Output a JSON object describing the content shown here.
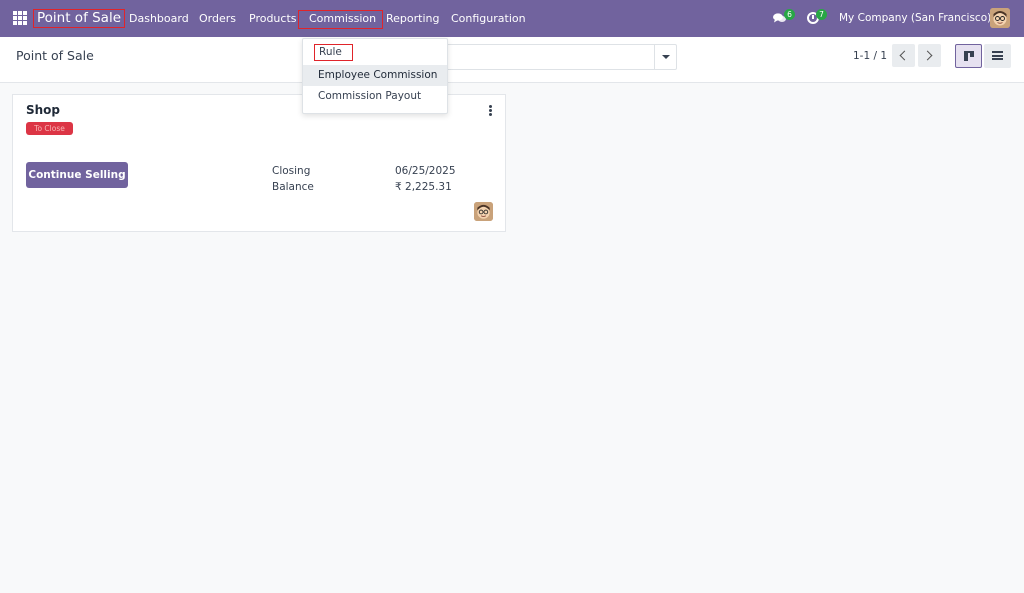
{
  "navbar": {
    "brand": "Point of Sale",
    "menu": [
      "Dashboard",
      "Orders",
      "Products",
      "Commission",
      "Reporting",
      "Configuration"
    ],
    "messages_count": "6",
    "activities_count": "7",
    "company": "My Company (San Francisco)"
  },
  "control_panel": {
    "title": "Point of Sale",
    "pager": "1-1 / 1"
  },
  "dropdown": {
    "items": [
      "Rule",
      "Employee Commission",
      "Commission Payout"
    ]
  },
  "card": {
    "title": "Shop",
    "status": "To Close",
    "button": "Continue Selling",
    "closing_label": "Closing",
    "closing_value": "06/25/2025",
    "balance_label": "Balance",
    "balance_value": "₹ 2,225.31"
  },
  "colors": {
    "brand": "#71639e",
    "highlight": "#e0242a",
    "status": "#dc3545",
    "badge": "#28a745"
  }
}
